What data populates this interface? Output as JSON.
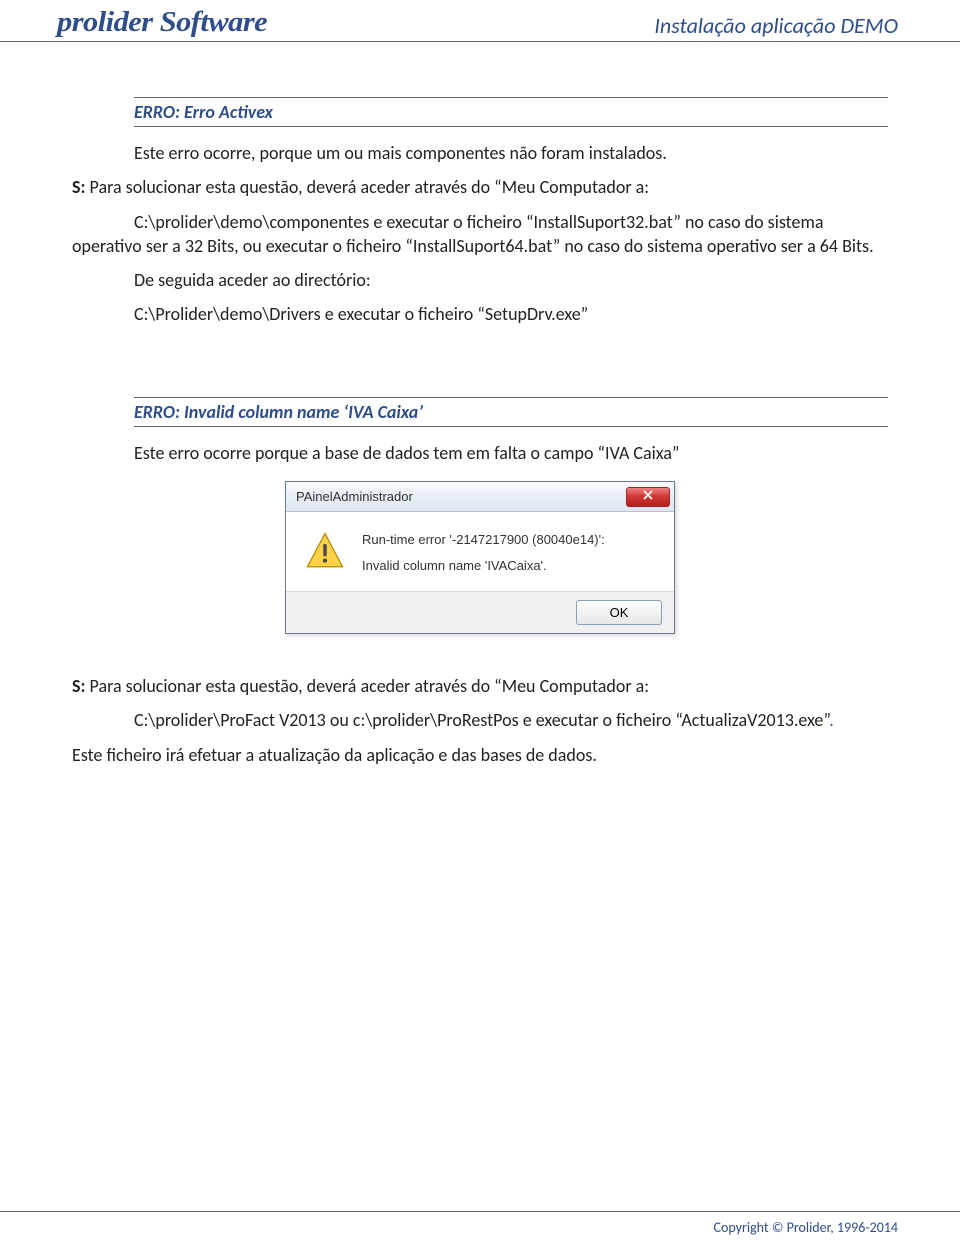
{
  "header": {
    "logo": "prolider Software",
    "doc_title": "Instalação aplicação DEMO"
  },
  "section1": {
    "heading": "ERRO: Erro Activex",
    "p1": "Este erro ocorre, porque um ou mais componentes não foram instalados.",
    "p2_prefix": "S:",
    "p2_rest": " Para solucionar esta questão, deverá aceder através do “Meu Computador a:",
    "p3": "C:\\prolider\\demo\\componentes e executar o ficheiro “InstallSuport32.bat” no caso do sistema operativo ser a 32 Bits, ou executar o ficheiro “InstallSuport64.bat” no caso do sistema operativo ser a 64 Bits.",
    "p4": "De seguida aceder ao directório:",
    "p5": "C:\\Prolider\\demo\\Drivers e executar o ficheiro “SetupDrv.exe”"
  },
  "section2": {
    "heading": "ERRO: Invalid column name ‘IVA Caixa’",
    "p1": "Este erro ocorre porque a base de dados tem em falta o campo “IVA Caixa”"
  },
  "dialog": {
    "title": "PAinelAdministrador",
    "line1": "Run-time error '-2147217900 (80040e14)':",
    "line2": "Invalid column name 'IVACaixa'.",
    "ok": "OK"
  },
  "section3": {
    "p1_prefix": "S:",
    "p1_rest": " Para solucionar esta questão, deverá aceder através do “Meu Computador a:",
    "p2_text": "C:\\prolider\\ProFact V2013 ou c:\\prolider\\ProRestPos e executar o ficheiro “ActualizaV2013.exe”",
    "p2_tail": ".",
    "p3": "Este ficheiro irá efetuar a atualização da aplicação e das bases de dados."
  },
  "footer": {
    "copyright": "Copyright © Prolider, 1996-2014"
  }
}
